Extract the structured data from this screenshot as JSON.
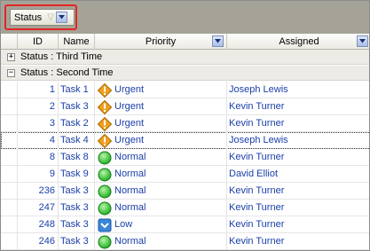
{
  "group_panel": {
    "chip_label": "Status",
    "filter_icon": "filter-icon",
    "dropdown_icon": "chevron-down-icon"
  },
  "columns": {
    "id": "ID",
    "name": "Name",
    "priority": "Priority",
    "assigned": "Assigned"
  },
  "groups": [
    {
      "label": "Status : Third Time",
      "expanded": false
    },
    {
      "label": "Status : Second Time",
      "expanded": true
    }
  ],
  "rows": [
    {
      "id": "1",
      "name": "Task 1",
      "priority": "Urgent",
      "icon": "urgent",
      "assigned": "Joseph Lewis"
    },
    {
      "id": "2",
      "name": "Task 3",
      "priority": "Urgent",
      "icon": "urgent",
      "assigned": "Kevin Turner"
    },
    {
      "id": "3",
      "name": "Task 2",
      "priority": "Urgent",
      "icon": "urgent",
      "assigned": "Kevin Turner"
    },
    {
      "id": "4",
      "name": "Task 4",
      "priority": "Urgent",
      "icon": "urgent",
      "assigned": "Joseph Lewis"
    },
    {
      "id": "8",
      "name": "Task 8",
      "priority": "Normal",
      "icon": "normal",
      "assigned": "Kevin Turner"
    },
    {
      "id": "9",
      "name": "Task 9",
      "priority": "Normal",
      "icon": "normal",
      "assigned": "David Elliot"
    },
    {
      "id": "236",
      "name": "Task 3",
      "priority": "Normal",
      "icon": "normal",
      "assigned": "Kevin Turner"
    },
    {
      "id": "247",
      "name": "Task 3",
      "priority": "Normal",
      "icon": "normal",
      "assigned": "Kevin Turner"
    },
    {
      "id": "248",
      "name": "Task 3",
      "priority": "Low",
      "icon": "low",
      "assigned": "Kevin Turner"
    },
    {
      "id": "246",
      "name": "Task 3",
      "priority": "Normal",
      "icon": "normal",
      "assigned": "Kevin Turner"
    }
  ],
  "colors": {
    "group_panel_bg": "#a5a397",
    "cell_text": "#1a3fa8",
    "highlight": "#e22525",
    "urgent": "#f0a020",
    "normal": "#22b022",
    "low": "#3a86d8"
  }
}
